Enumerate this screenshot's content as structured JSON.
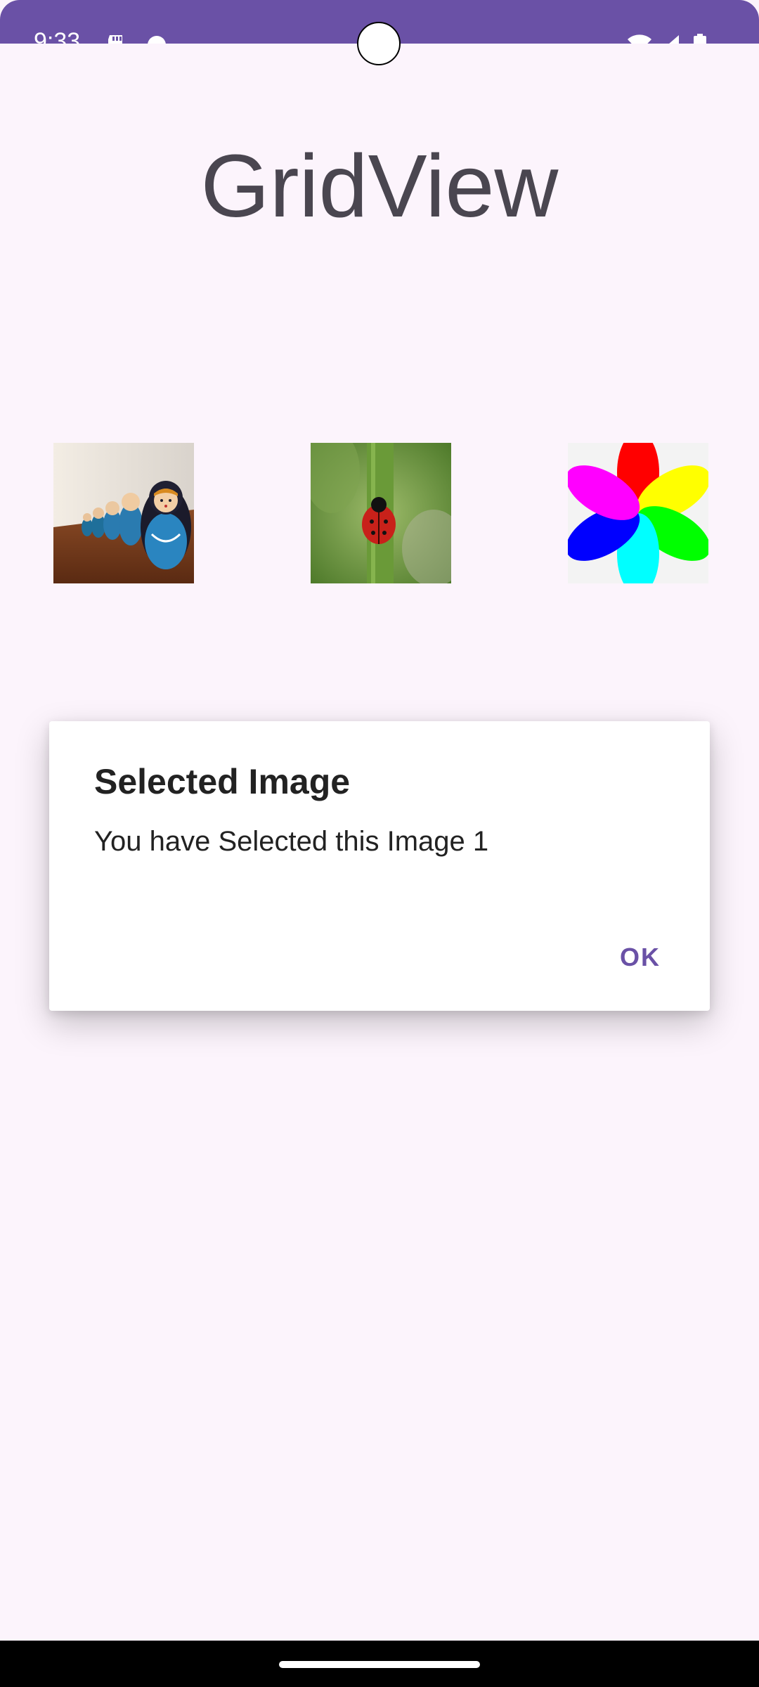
{
  "status_bar": {
    "time": "9:33",
    "icons": [
      "sd-card-icon",
      "android-debug-icon",
      "wifi-icon",
      "signal-icon",
      "battery-icon"
    ],
    "color": "#6a51a6"
  },
  "app": {
    "title": "GridView",
    "background": "#fcf4fc"
  },
  "grid": {
    "items": [
      {
        "name": "grid-image-matryoshka",
        "icon": "matryoshka-dolls-photo"
      },
      {
        "name": "grid-image-ladybug",
        "icon": "ladybug-photo"
      },
      {
        "name": "grid-image-pinwheel",
        "icon": "pinwheel-flower-icon"
      }
    ]
  },
  "dialog": {
    "title": "Selected Image",
    "message": "You have Selected this Image 1",
    "ok_label": "OK",
    "accent": "#6a51a6"
  },
  "nav_bar": {
    "color": "#000000"
  }
}
